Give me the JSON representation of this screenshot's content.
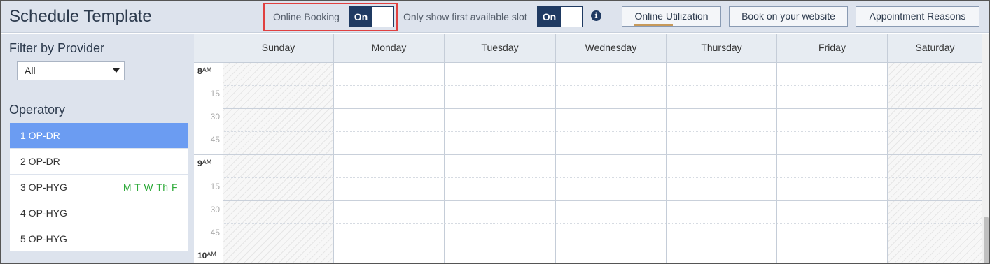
{
  "header": {
    "title": "Schedule Template",
    "online_booking": {
      "label": "Online Booking",
      "state": "On"
    },
    "first_slot": {
      "label": "Only show first available slot",
      "state": "On"
    },
    "info_icon": "i",
    "buttons": {
      "utilization": "Online Utilization",
      "website": "Book on your website",
      "reasons": "Appointment Reasons"
    }
  },
  "sidebar": {
    "filter_title": "Filter by Provider",
    "provider_select": "All",
    "operatory_title": "Operatory",
    "operatories": [
      {
        "label": "1 OP-DR",
        "days": "",
        "active": true
      },
      {
        "label": "2 OP-DR",
        "days": ""
      },
      {
        "label": "3 OP-HYG",
        "days": "M T W Th F"
      },
      {
        "label": "4 OP-HYG",
        "days": ""
      },
      {
        "label": "5 OP-HYG",
        "days": ""
      }
    ]
  },
  "calendar": {
    "days": [
      "Sunday",
      "Monday",
      "Tuesday",
      "Wednesday",
      "Thursday",
      "Friday",
      "Saturday"
    ],
    "hours": [
      {
        "hour": "8",
        "suffix": "AM"
      },
      {
        "hour": "9",
        "suffix": "AM"
      },
      {
        "hour": "10",
        "suffix": "AM"
      }
    ],
    "quarters": [
      "15",
      "30",
      "45"
    ]
  },
  "colors": {
    "accent": "#1f3a62",
    "active_operatory": "#6b9cf2",
    "days_green": "#2eaa3a",
    "highlight_box": "#e04040"
  }
}
